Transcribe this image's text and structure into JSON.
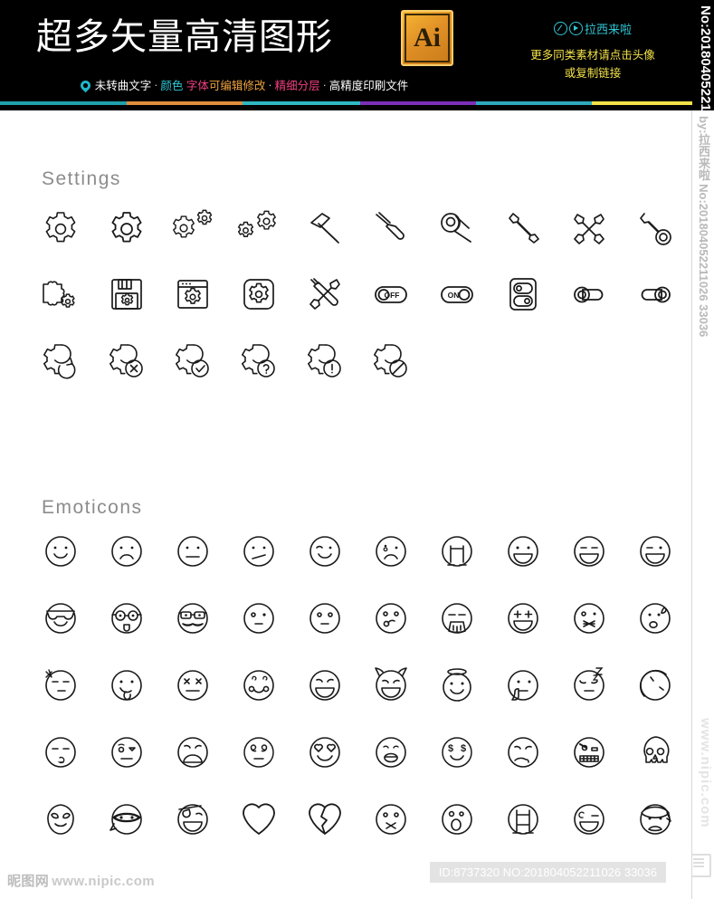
{
  "header": {
    "title": "超多矢量高清图形",
    "badge_label": "Ai",
    "features": {
      "f1": "未转曲文字",
      "dot1": "·",
      "f2": "颜色",
      "f3": "字体",
      "f4": "可编辑修改",
      "dot2": "·",
      "f5": "精细分层",
      "dot3": "·",
      "f6": "高精度印刷文件"
    },
    "right": {
      "line1": "拉西来啦",
      "line2": "更多同类素材请点击头像",
      "line3": "或复制链接"
    },
    "bar_colors": [
      "#1fa0ad",
      "#e08f3c",
      "#2fb8c4",
      "#7b2fb8",
      "#2fa8bd",
      "#f2e14a"
    ]
  },
  "vertical_strip": {
    "code": "No:201804052211026 33036",
    "author": "by:拉西来啦",
    "watermark": "www.nipic.com"
  },
  "sections": [
    {
      "title": "Settings",
      "rows": [
        [
          "gear-icon",
          "gear-solid-icon",
          "gears-double-icon",
          "gears-triple-icon",
          "hammer-icon",
          "screwdriver-icon",
          "ratchet-wrench-icon",
          "wrench-icon",
          "crossed-wrenches-icon",
          "combination-wrench-icon"
        ],
        [
          "puzzle-gear-icon",
          "floppy-gear-icon",
          "browser-gear-icon",
          "app-gear-icon",
          "wrench-screwdriver-icon",
          "toggle-off-icon",
          "toggle-on-icon",
          "dual-switch-icon",
          "slider-left-icon",
          "slider-right-icon"
        ],
        [
          "gear-refresh-icon",
          "gear-close-icon",
          "gear-check-icon",
          "gear-help-icon",
          "gear-alert-icon",
          "gear-blocked-icon"
        ]
      ]
    },
    {
      "title": "Emoticons",
      "rows": [
        [
          "smile-icon",
          "frown-icon",
          "neutral-icon",
          "confused-icon",
          "wink-smile-icon",
          "crying-icon",
          "sobbing-icon",
          "grin-icon",
          "laugh-closed-eyes-icon",
          "laugh-wink-icon"
        ],
        [
          "sunglasses-icon",
          "nerd-icon",
          "mustache-glasses-icon",
          "expressionless-icon",
          "blank-icon",
          "whistle-icon",
          "vomit-icon",
          "star-eyes-icon",
          "zipper-mouth-icon",
          "sweat-surprise-icon"
        ],
        [
          "angry-vein-icon",
          "tongue-out-icon",
          "dead-eyes-icon",
          "blush-icon",
          "happy-laugh-icon",
          "devil-icon",
          "angel-icon",
          "shush-icon",
          "sleeping-icon",
          "sliced-face-icon"
        ],
        [
          "kiss-icon",
          "wink-flirt-icon",
          "worried-icon",
          "dizzy-icon",
          "heart-eyes-icon",
          "teeth-smile-icon",
          "money-eyes-icon",
          "sick-icon",
          "gritted-teeth-icon",
          "skull-icon"
        ],
        [
          "alien-icon",
          "ninja-icon",
          "pirate-icon",
          "heart-icon",
          "broken-heart-icon",
          "sealed-lips-icon",
          "shocked-icon",
          "braces-icon",
          "smirk-wink-icon",
          "bandaged-icon"
        ]
      ]
    }
  ],
  "footer": {
    "watermark_cn": "昵图网",
    "watermark_url": "www.nipic.com",
    "id_label": "ID:8737320 NO:201804052211026 33036"
  }
}
